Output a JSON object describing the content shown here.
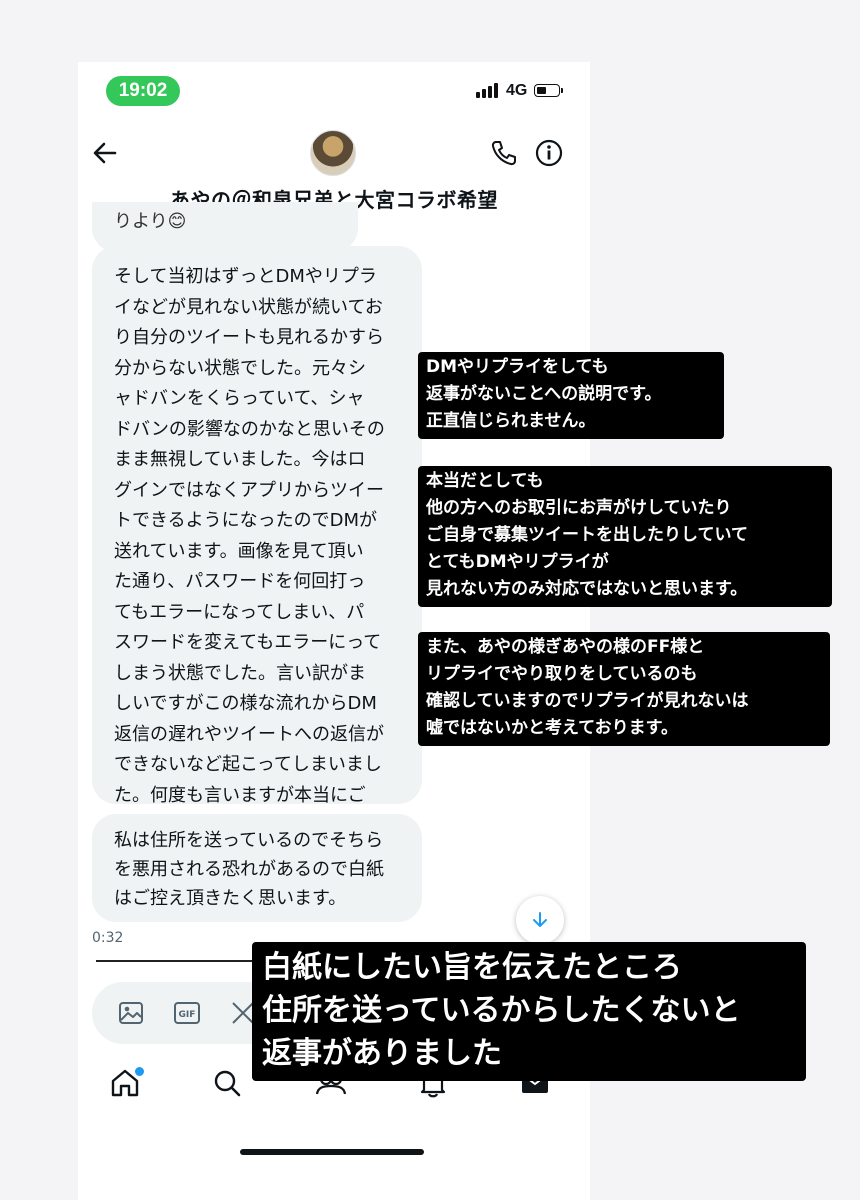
{
  "status_bar": {
    "time": "19:02",
    "network": "4G"
  },
  "header": {
    "title": "あやの＠和泉兄弟と大宮コラボ希望"
  },
  "chat": {
    "partial_message": "りより😊",
    "message_1": "そして当初はずっとDMやリプラ\nイなどが見れない状態が続いてお\nり自分のツイートも見れるかすら\n分からない状態でした。元々シ\nャドバンをくらっていて、シャ\nドバンの影響なのかなと思いその\nまま無視していました。今はロ\nグインではなくアプリからツイー\nトできるようになったのでDMが\n送れています。画像を見て頂い\nた通り、パスワードを何回打っ\nてもエラーになってしまい、パ\nスワードを変えてもエラーにって\nしまう状態でした。言い訳がま\nしいですがこの様な流れからDM\n返信の遅れやツイートへの返信が\nできないなど起こってしまいまし\nた。何度も言いますが本当にご\n迷惑お掛けしてしまい申し訳あり\nません。",
    "message_2": "私は住所を送っているのでそちら\nを悪用される恐れがあるので白紙\nはご控え頂きたく思います。",
    "timestamp": "0:32"
  },
  "composer": {
    "icons": [
      "image-icon",
      "gif-icon",
      "message-icon"
    ]
  },
  "nav": {
    "items": [
      "home-icon",
      "search-icon",
      "communities-icon",
      "notifications-icon",
      "messages-icon"
    ]
  },
  "annotations": {
    "note_1": "DMやリプライをしても\n返事がないことへの説明です。\n正直信じられません。",
    "note_2": "本当だとしても\n他の方へのお取引にお声がけしていたり\nご自身で募集ツイートを出したりしていて\nとてもDMやリプライが\n見れない方のみ対応ではないと思います。",
    "note_3": "また、あやの様ぎあやの様のFF様と\nリプライでやり取りをしているのも\n確認していますのでリプライが見れないは\n嘘ではないかと考えております。",
    "note_4": "白紙にしたい旨を伝えたところ\n住所を送っているからしたくないと\n返事がありました"
  },
  "colors": {
    "accent": "#1d9bf0",
    "time_pill": "#34c759",
    "bubble": "#eff3f4",
    "annotation_bg": "#000000"
  }
}
